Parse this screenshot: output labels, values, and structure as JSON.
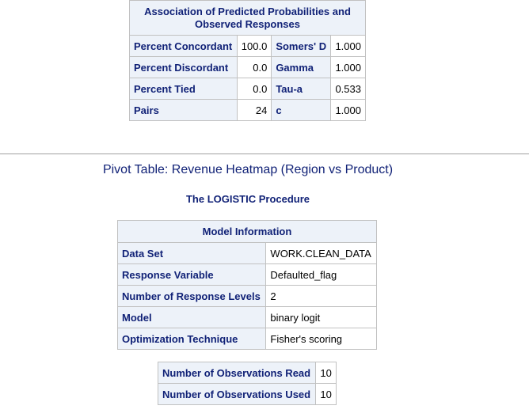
{
  "association": {
    "caption_line1": "Association of Predicted Probabilities and",
    "caption_line2": "Observed Responses",
    "rows": [
      {
        "label1": "Percent Concordant",
        "value1": "100.0",
        "label2": "Somers' D",
        "value2": "1.000"
      },
      {
        "label1": "Percent Discordant",
        "value1": "0.0",
        "label2": "Gamma",
        "value2": "1.000"
      },
      {
        "label1": "Percent Tied",
        "value1": "0.0",
        "label2": "Tau-a",
        "value2": "0.533"
      },
      {
        "label1": "Pairs",
        "value1": "24",
        "label2": "c",
        "value2": "1.000"
      }
    ]
  },
  "page_title": "Pivot Table: Revenue Heatmap (Region vs Product)",
  "procedure_title": "The LOGISTIC Procedure",
  "model_info": {
    "caption": "Model Information",
    "rows": [
      {
        "label": "Data Set",
        "value": "WORK.CLEAN_DATA"
      },
      {
        "label": "Response Variable",
        "value": "Defaulted_flag"
      },
      {
        "label": "Number of Response Levels",
        "value": "2"
      },
      {
        "label": "Model",
        "value": "binary logit"
      },
      {
        "label": "Optimization Technique",
        "value": "Fisher's scoring"
      }
    ]
  },
  "observations": {
    "rows": [
      {
        "label": "Number of Observations Read",
        "value": "10"
      },
      {
        "label": "Number of Observations Used",
        "value": "10"
      }
    ]
  },
  "colors": {
    "header_bg": "#edf2f9",
    "header_text": "#112277",
    "grid_line": "#c1c1c1"
  }
}
